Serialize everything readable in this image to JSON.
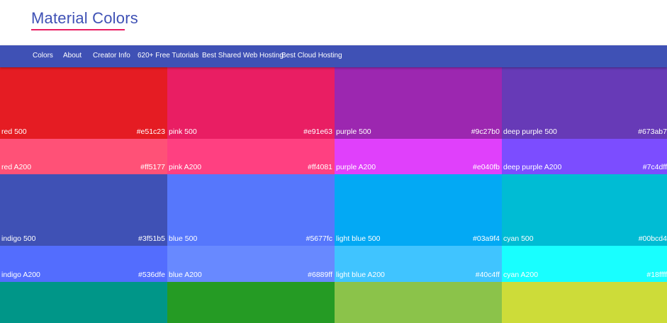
{
  "brand": {
    "title": "Material Colors",
    "underline_color": "#e91e63"
  },
  "nav": {
    "background": "#3f51b5",
    "items": [
      "Colors",
      "About",
      "Creator Info",
      "620+ Free Tutorials",
      "Best Shared Web Hosting",
      "Best Cloud Hosting"
    ]
  },
  "swatches": [
    {
      "name": "red 500",
      "hex": "#e51c23"
    },
    {
      "name": "pink 500",
      "hex": "#e91e63"
    },
    {
      "name": "purple 500",
      "hex": "#9c27b0"
    },
    {
      "name": "deep purple 500",
      "hex": "#673ab7"
    },
    {
      "name": "red A200",
      "hex": "#ff5177"
    },
    {
      "name": "pink A200",
      "hex": "#ff4081"
    },
    {
      "name": "purple A200",
      "hex": "#e040fb"
    },
    {
      "name": "deep purple A200",
      "hex": "#7c4dff"
    },
    {
      "name": "indigo 500",
      "hex": "#3f51b5"
    },
    {
      "name": "blue 500",
      "hex": "#5677fc"
    },
    {
      "name": "light blue 500",
      "hex": "#03a9f4"
    },
    {
      "name": "cyan 500",
      "hex": "#00bcd4"
    },
    {
      "name": "indigo A200",
      "hex": "#536dfe"
    },
    {
      "name": "blue A200",
      "hex": "#6889ff"
    },
    {
      "name": "light blue A200",
      "hex": "#40c4ff"
    },
    {
      "name": "cyan A200",
      "hex": "#18ffff"
    },
    {
      "name": "",
      "hex": "",
      "color": "#009688"
    },
    {
      "name": "",
      "hex": "",
      "color": "#259b24"
    },
    {
      "name": "",
      "hex": "",
      "color": "#8bc34a"
    },
    {
      "name": "",
      "hex": "",
      "color": "#cddc39"
    }
  ]
}
